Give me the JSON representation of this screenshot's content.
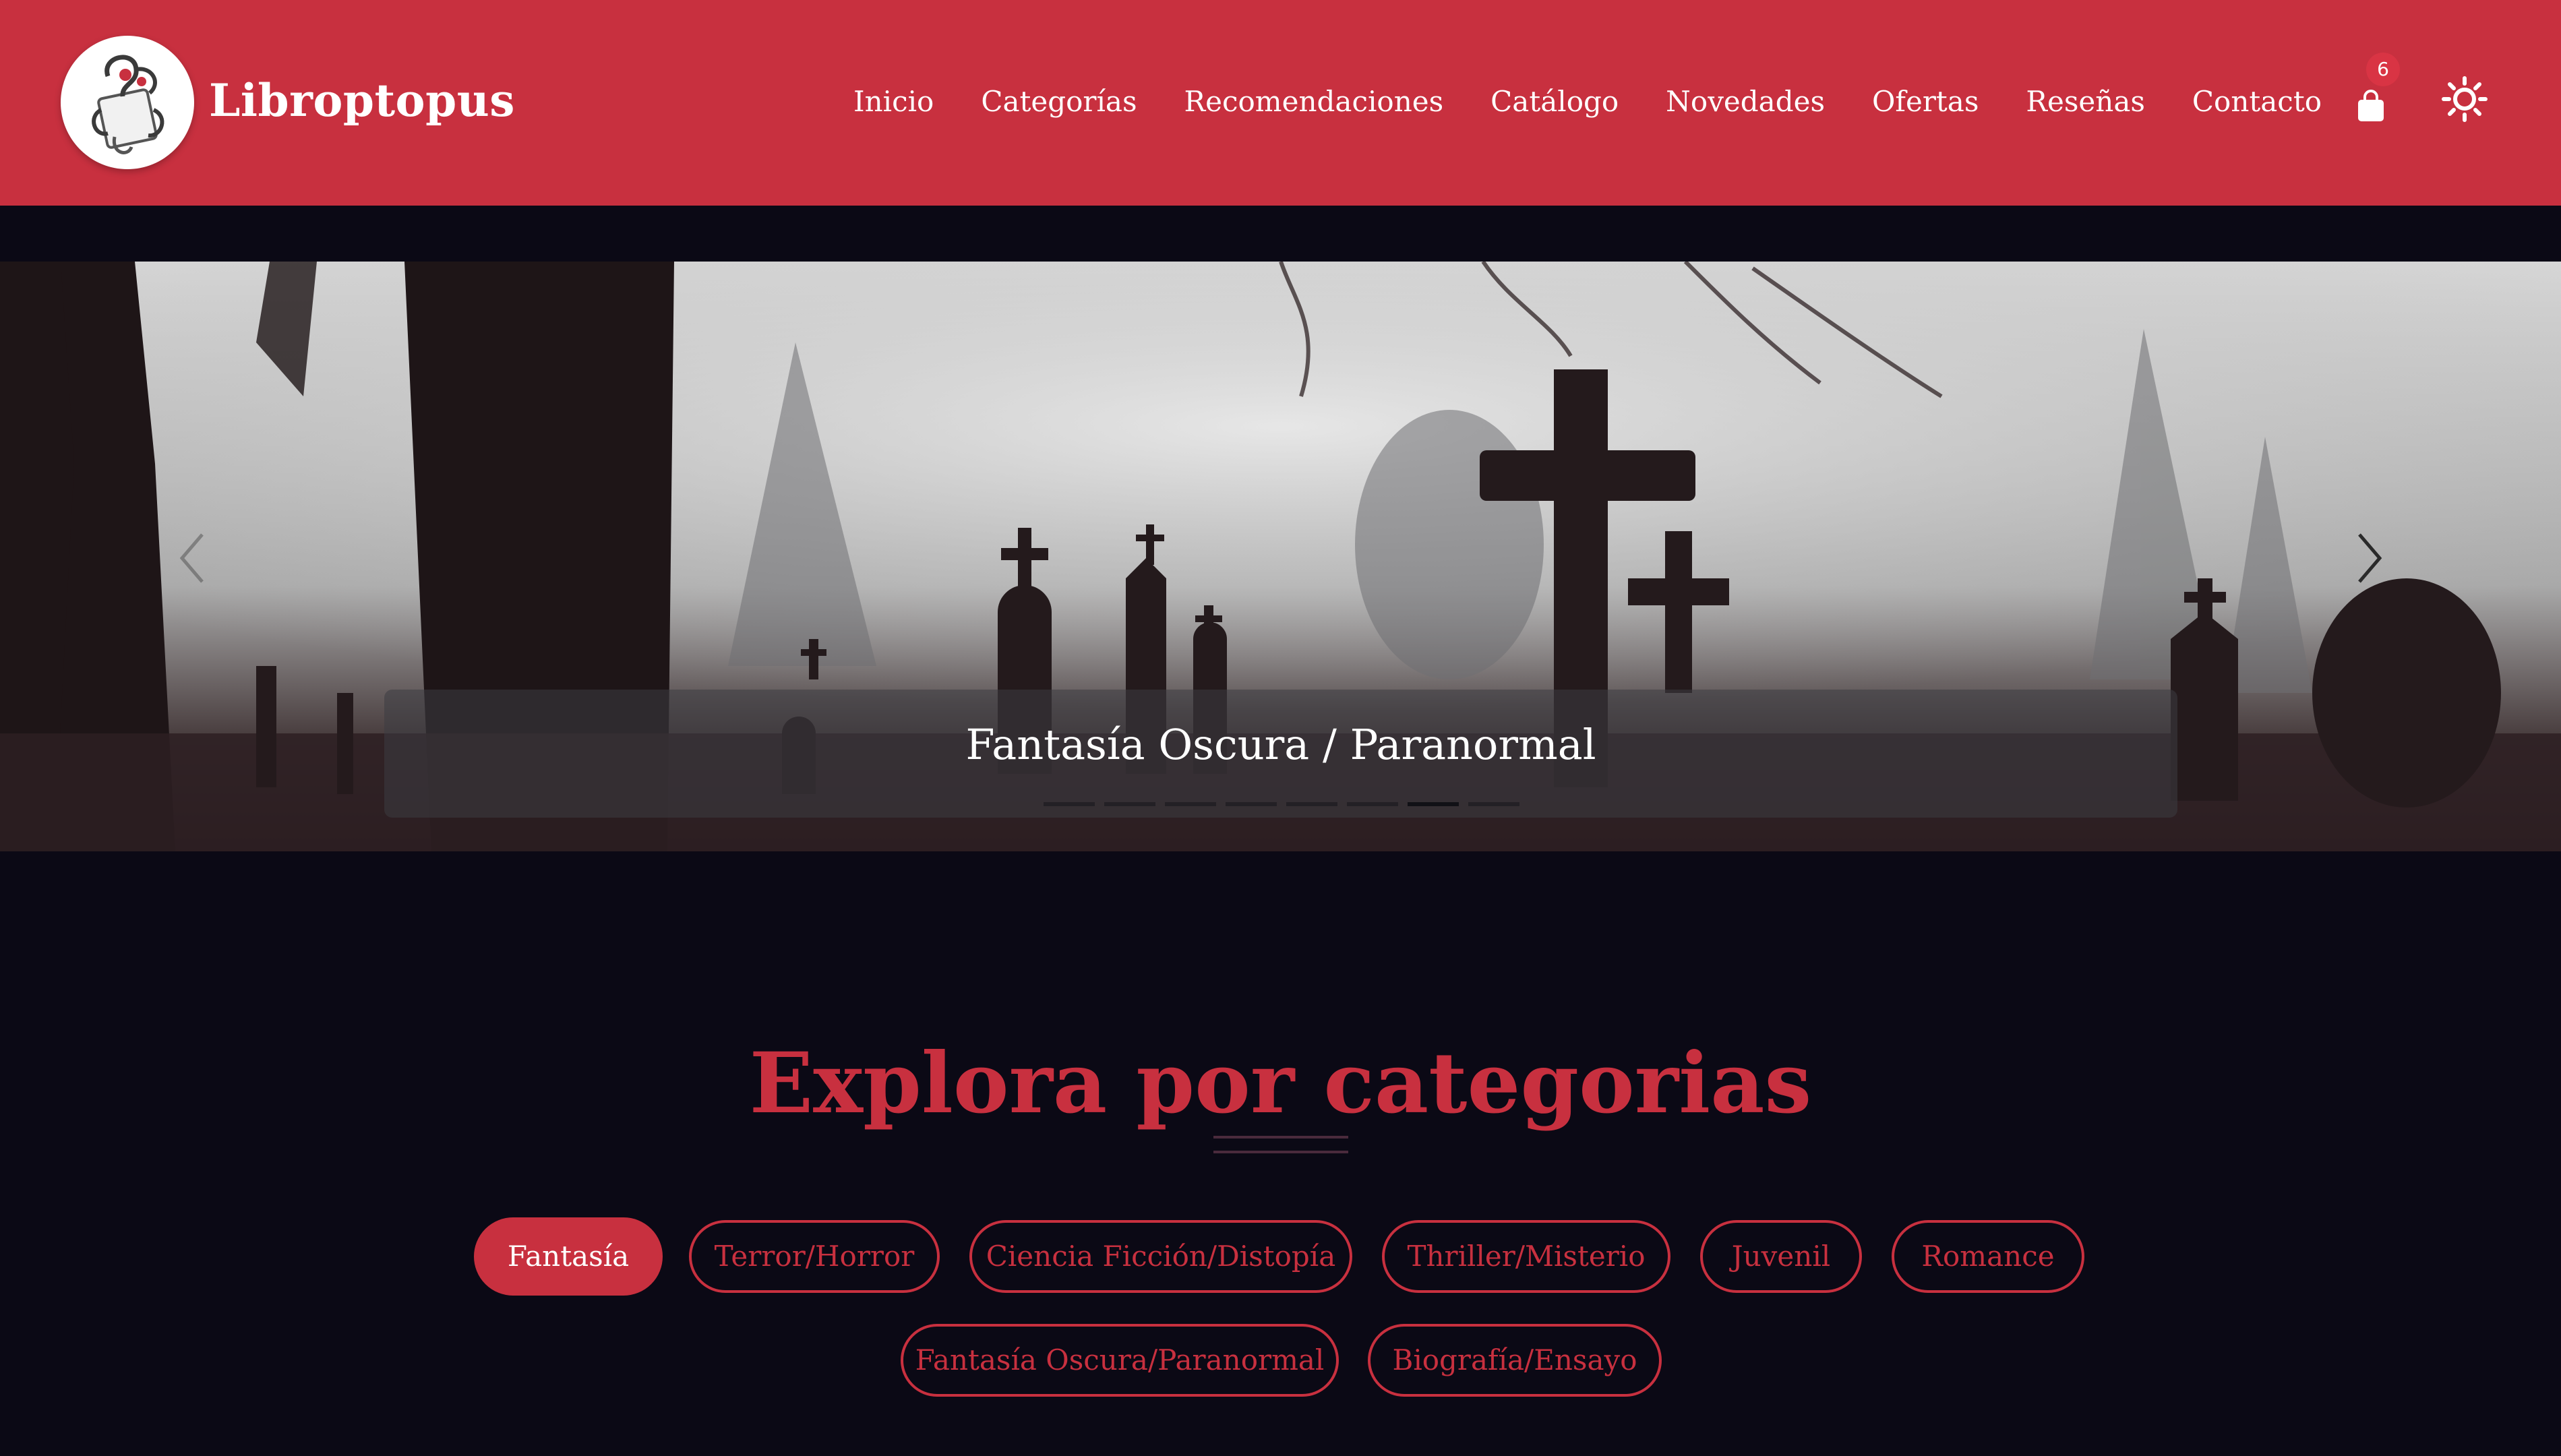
{
  "header": {
    "brand": "Libroptopus",
    "logo_icon": "octopus-book-logo",
    "nav": [
      {
        "label": "Inicio"
      },
      {
        "label": "Categorías"
      },
      {
        "label": "Recomendaciones"
      },
      {
        "label": "Catálogo"
      },
      {
        "label": "Novedades"
      },
      {
        "label": "Ofertas"
      },
      {
        "label": "Reseñas"
      },
      {
        "label": "Contacto"
      }
    ],
    "cart_icon": "shopping-bag-icon",
    "cart_count": "6",
    "theme_icon": "sun-icon",
    "colors": {
      "header_bg": "#c8303f",
      "text": "#ffffff",
      "badge": "#d93444"
    }
  },
  "hero": {
    "caption": "Fantasía Oscura / Paranormal",
    "slide_count": 8,
    "active_slide": 7,
    "prev_icon": "chevron-left-icon",
    "next_icon": "chevron-right-icon"
  },
  "categories": {
    "title": "Explora por categorias",
    "items": [
      {
        "label": "Fantasía",
        "active": true
      },
      {
        "label": "Terror/Horror",
        "active": false
      },
      {
        "label": "Ciencia Ficción/Distopía",
        "active": false
      },
      {
        "label": "Thriller/Misterio",
        "active": false
      },
      {
        "label": "Juvenil",
        "active": false
      },
      {
        "label": "Romance",
        "active": false
      },
      {
        "label": "Fantasía Oscura/Paranormal",
        "active": false
      },
      {
        "label": "Biografía/Ensayo",
        "active": false
      }
    ],
    "colors": {
      "accent": "#c8303f",
      "page_bg": "#0b0915"
    }
  }
}
